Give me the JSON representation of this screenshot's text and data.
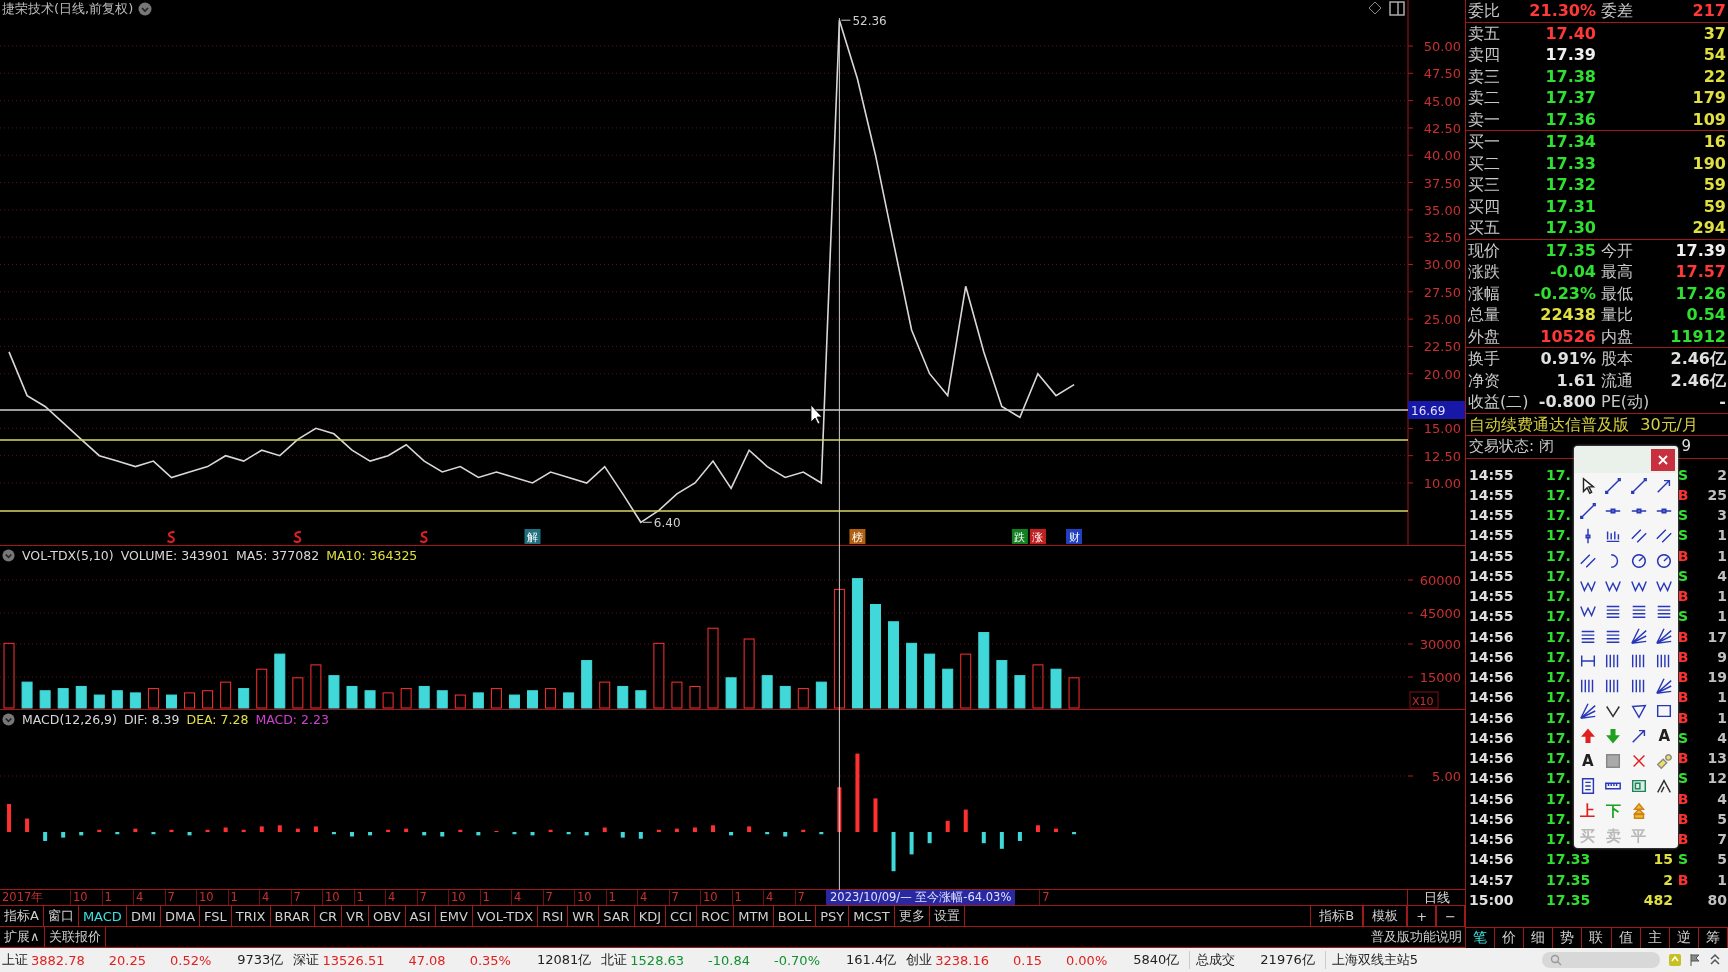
{
  "title": "捷荣技术(日线,前复权)",
  "price_pane": {
    "chart_data": {
      "type": "line",
      "grid": true,
      "ylim": [
        4.23,
        54.21
      ],
      "yticks": [
        {
          "value": 50,
          "label": "50.00"
        },
        {
          "value": 47.5,
          "label": "47.50"
        },
        {
          "value": 45,
          "label": "45.00"
        },
        {
          "value": 42.5,
          "label": "42.50"
        },
        {
          "value": 40,
          "label": "40.00"
        },
        {
          "value": 37.5,
          "label": "37.50"
        },
        {
          "value": 35,
          "label": "35.00"
        },
        {
          "value": 32.5,
          "label": "32.50"
        },
        {
          "value": 30,
          "label": "30.00"
        },
        {
          "value": 27.5,
          "label": "27.50"
        },
        {
          "value": 25,
          "label": "25.00"
        },
        {
          "value": 22.5,
          "label": "22.50"
        },
        {
          "value": 20,
          "label": "20.00"
        },
        {
          "value": 15,
          "label": "15.00"
        },
        {
          "value": 12.5,
          "label": "12.50"
        },
        {
          "value": 10,
          "label": "10.00"
        }
      ],
      "series": [
        {
          "color": "#d8d8d8",
          "values": [
            22,
            18,
            17,
            15.5,
            14,
            12.5,
            12,
            11.5,
            12,
            10.5,
            11,
            11.5,
            12.5,
            12,
            13,
            12.5,
            14,
            15,
            14.5,
            13,
            12,
            12.5,
            13.5,
            12,
            11,
            11.5,
            10.5,
            11,
            10.5,
            10,
            11,
            10.5,
            10,
            11.5,
            9,
            6.4,
            7.5,
            9,
            10,
            12,
            9.5,
            13,
            11.5,
            10.5,
            11,
            10,
            52.36,
            47,
            40,
            32,
            24,
            20,
            18,
            28,
            22,
            17,
            16,
            20,
            18,
            19
          ]
        }
      ],
      "annotations": [
        "52.36",
        "6.40"
      ]
    },
    "crosshair_label": "16.69",
    "markers": [
      {
        "kind": "flag"
      },
      {
        "kind": "flag"
      },
      {
        "kind": "flag"
      },
      {
        "kind": "tag",
        "label": "解",
        "color": "#207080"
      },
      {
        "kind": "tag",
        "label": "榜",
        "color": "#b06010"
      },
      {
        "kind": "tag",
        "label": "跌",
        "color": "#108020"
      },
      {
        "kind": "tag",
        "label": "涨",
        "color": "#c02020"
      },
      {
        "kind": "tag",
        "label": "财",
        "color": "#2040c0"
      }
    ]
  },
  "volume_pane": {
    "header": [
      {
        "text": "VOL-TDX(5,10)"
      },
      {
        "text": "VOLUME: 343901"
      },
      {
        "text": "MA5: 377082"
      },
      {
        "text": "MA10: 364325",
        "color": "#e0e040"
      }
    ],
    "scale_label": "X10",
    "axis_labels": [
      "60000",
      "45000",
      "30000",
      "15000"
    ]
  },
  "macd_pane": {
    "header": [
      {
        "text": "MACD(12,26,9)"
      },
      {
        "text": "DIF: 8.39"
      },
      {
        "text": "DEA: 7.28",
        "color": "#e0e040"
      },
      {
        "text": "MACD: 2.23",
        "color": "#d040d0"
      }
    ],
    "axis_labels": [
      "5.00"
    ]
  },
  "date_axis": {
    "labels": [
      "2017年",
      "10",
      "1",
      "4",
      "7",
      "10",
      "1",
      "4",
      "7",
      "10",
      "1",
      "4",
      "7",
      "10",
      "1",
      "4",
      "7",
      "10",
      "1",
      "4",
      "7",
      "10",
      "1",
      "4",
      "7"
    ],
    "highlight": "2023/10/09/— 至今涨幅-64.03%",
    "after": "7",
    "period": "日线"
  },
  "indicator_tabs": [
    {
      "label": "指标A",
      "selected": false
    },
    {
      "label": "窗口",
      "selected": false
    },
    {
      "label": "MACD",
      "selected": true
    },
    {
      "label": "DMI",
      "selected": false
    },
    {
      "label": "DMA",
      "selected": false
    },
    {
      "label": "FSL",
      "selected": false
    },
    {
      "label": "TRIX",
      "selected": false
    },
    {
      "label": "BRAR",
      "selected": false
    },
    {
      "label": "CR",
      "selected": false
    },
    {
      "label": "VR",
      "selected": false
    },
    {
      "label": "OBV",
      "selected": false
    },
    {
      "label": "ASI",
      "selected": false
    },
    {
      "label": "EMV",
      "selected": false
    },
    {
      "label": "VOL-TDX",
      "selected": false
    },
    {
      "label": "RSI",
      "selected": false
    },
    {
      "label": "WR",
      "selected": false
    },
    {
      "label": "SAR",
      "selected": false
    },
    {
      "label": "KDJ",
      "selected": false
    },
    {
      "label": "CCI",
      "selected": false
    },
    {
      "label": "ROC",
      "selected": false
    },
    {
      "label": "MTM",
      "selected": false
    },
    {
      "label": "BOLL",
      "selected": false
    },
    {
      "label": "PSY",
      "selected": false
    },
    {
      "label": "MCST",
      "selected": false
    },
    {
      "label": "更多",
      "selected": false
    },
    {
      "label": "设置",
      "selected": false
    }
  ],
  "right_buttons": [
    "指标B",
    "模板",
    "+",
    "−"
  ],
  "extension_buttons": [
    "扩展∧",
    "关联报价"
  ],
  "help_link": "普及版功能说明",
  "quote": {
    "ratio": {
      "left": {
        "label": "委比",
        "value": "21.30%",
        "color": "#ff3838"
      },
      "right": {
        "label": "委差",
        "value": "217",
        "color": "#ff3838"
      }
    },
    "asks": [
      {
        "label": "卖五",
        "price": "17.40",
        "color": "#ff3838",
        "volume": "37"
      },
      {
        "label": "卖四",
        "price": "17.39",
        "color": "#f0f0f0",
        "volume": "54"
      },
      {
        "label": "卖三",
        "price": "17.38",
        "color": "#30e030",
        "volume": "22"
      },
      {
        "label": "卖二",
        "price": "17.37",
        "color": "#30e030",
        "volume": "179"
      },
      {
        "label": "卖一",
        "price": "17.36",
        "color": "#30e030",
        "volume": "109"
      }
    ],
    "bids": [
      {
        "label": "买一",
        "price": "17.34",
        "color": "#30e030",
        "volume": "16"
      },
      {
        "label": "买二",
        "price": "17.33",
        "color": "#30e030",
        "volume": "190"
      },
      {
        "label": "买三",
        "price": "17.32",
        "color": "#30e030",
        "volume": "59"
      },
      {
        "label": "买四",
        "price": "17.31",
        "color": "#30e030",
        "volume": "59"
      },
      {
        "label": "买五",
        "price": "17.30",
        "color": "#30e030",
        "volume": "294"
      }
    ],
    "stats": [
      {
        "left": {
          "label": "现价",
          "value": "17.35",
          "color": "#30e030"
        },
        "right": {
          "label": "今开",
          "value": "17.39",
          "color": "#f0f0f0"
        }
      },
      {
        "left": {
          "label": "涨跌",
          "value": "-0.04",
          "color": "#30e030"
        },
        "right": {
          "label": "最高",
          "value": "17.57",
          "color": "#ff3838"
        }
      },
      {
        "left": {
          "label": "涨幅",
          "value": "-0.23%",
          "color": "#30e030"
        },
        "right": {
          "label": "最低",
          "value": "17.26",
          "color": "#30e030"
        }
      },
      {
        "left": {
          "label": "总量",
          "value": "22438",
          "color": "#e0e040"
        },
        "right": {
          "label": "量比",
          "value": "0.54",
          "color": "#30e030"
        }
      },
      {
        "left": {
          "label": "外盘",
          "value": "10526",
          "color": "#ff3838"
        },
        "right": {
          "label": "内盘",
          "value": "11912",
          "color": "#30e030"
        }
      }
    ],
    "fundamentals": [
      {
        "left": {
          "label": "换手",
          "value": "0.91%"
        },
        "right": {
          "label": "股本",
          "value": "2.46亿"
        }
      },
      {
        "left": {
          "label": "净资",
          "value": "1.61"
        },
        "right": {
          "label": "流通",
          "value": "2.46亿"
        }
      },
      {
        "left": {
          "label": "收益(二)",
          "value": "-0.800"
        },
        "right": {
          "label": "PE(动)",
          "value": "-"
        }
      }
    ],
    "promo": {
      "text": "自动续费通达信普及版",
      "price": "30元/月"
    },
    "trade_status": {
      "text": "交易状态: 闭",
      "suffix": "9"
    }
  },
  "ticks": [
    {
      "time": "14:55",
      "price": "17.",
      "side": "S",
      "buy": false,
      "count": "2"
    },
    {
      "time": "14:55",
      "price": "17.",
      "side": "B",
      "buy": true,
      "count": "25"
    },
    {
      "time": "14:55",
      "price": "17.",
      "side": "S",
      "buy": false,
      "count": "3"
    },
    {
      "time": "14:55",
      "price": "17.",
      "side": "S",
      "buy": false,
      "count": "1"
    },
    {
      "time": "14:55",
      "price": "17.",
      "side": "B",
      "buy": true,
      "count": "1"
    },
    {
      "time": "14:55",
      "price": "17.",
      "side": "S",
      "buy": false,
      "count": "4"
    },
    {
      "time": "14:55",
      "price": "17.",
      "side": "B",
      "buy": true,
      "count": "1"
    },
    {
      "time": "14:55",
      "price": "17.",
      "side": "S",
      "buy": false,
      "count": "1"
    },
    {
      "time": "14:56",
      "price": "17.",
      "side": "B",
      "buy": true,
      "count": "17"
    },
    {
      "time": "14:56",
      "price": "17.",
      "side": "B",
      "buy": true,
      "count": "9"
    },
    {
      "time": "14:56",
      "price": "17.",
      "side": "B",
      "buy": true,
      "count": "19"
    },
    {
      "time": "14:56",
      "price": "17.",
      "side": "B",
      "buy": true,
      "count": "1"
    },
    {
      "time": "14:56",
      "price": "17.",
      "side": "B",
      "buy": true,
      "count": "1"
    },
    {
      "time": "14:56",
      "price": "17.",
      "side": "S",
      "buy": false,
      "count": "4"
    },
    {
      "time": "14:56",
      "price": "17.",
      "side": "B",
      "buy": true,
      "count": "13"
    },
    {
      "time": "14:56",
      "price": "17.",
      "side": "S",
      "buy": false,
      "count": "12"
    },
    {
      "time": "14:56",
      "price": "17.",
      "side": "B",
      "buy": true,
      "count": "4"
    },
    {
      "time": "14:56",
      "price": "17.",
      "side": "B",
      "buy": true,
      "count": "5"
    },
    {
      "time": "14:56",
      "price": "17.",
      "side": "B",
      "buy": true,
      "count": "7"
    },
    {
      "time": "14:56",
      "price": "17.33",
      "volume": "15",
      "side": "S",
      "buy": false,
      "count": "5"
    },
    {
      "time": "14:57",
      "price": "17.35",
      "volume": "2",
      "side": "B",
      "buy": true,
      "count": "1"
    },
    {
      "time": "15:00",
      "price": "17.35",
      "volume": "482",
      "count": "80"
    }
  ],
  "panel_tabs": [
    {
      "label": "笔",
      "selected": true
    },
    {
      "label": "价",
      "selected": false
    },
    {
      "label": "细",
      "selected": false
    },
    {
      "label": "势",
      "selected": false
    },
    {
      "label": "联",
      "selected": false
    },
    {
      "label": "值",
      "selected": false
    },
    {
      "label": "主",
      "selected": false
    },
    {
      "label": "逆",
      "selected": false
    },
    {
      "label": "筹",
      "selected": false
    }
  ],
  "palette": {
    "rows": [
      [
        {
          "kind": "cursor"
        },
        {
          "kind": "line"
        },
        {
          "kind": "line"
        },
        {
          "kind": "arrow"
        }
      ],
      [
        {
          "kind": "line"
        },
        {
          "kind": "segment"
        },
        {
          "kind": "segment"
        },
        {
          "kind": "segment"
        }
      ],
      [
        {
          "kind": "vertical"
        },
        {
          "kind": "scale"
        },
        {
          "kind": "parallel"
        },
        {
          "kind": "parallel"
        }
      ],
      [
        {
          "kind": "parallel"
        },
        {
          "kind": "arc"
        },
        {
          "kind": "circle"
        },
        {
          "kind": "circle"
        }
      ],
      [
        {
          "kind": "wave"
        },
        {
          "kind": "wave"
        },
        {
          "kind": "wave"
        },
        {
          "kind": "wave"
        }
      ],
      [
        {
          "kind": "wave"
        },
        {
          "kind": "lines"
        },
        {
          "kind": "lines"
        },
        {
          "kind": "lines"
        }
      ],
      [
        {
          "kind": "lines"
        },
        {
          "kind": "lines"
        },
        {
          "kind": "fan"
        },
        {
          "kind": "fan"
        }
      ],
      [
        {
          "kind": "period"
        },
        {
          "kind": "bars"
        },
        {
          "kind": "bars"
        },
        {
          "kind": "bars"
        }
      ],
      [
        {
          "kind": "bars"
        },
        {
          "kind": "bars"
        },
        {
          "kind": "bars"
        },
        {
          "kind": "fan"
        }
      ],
      [
        {
          "kind": "fan"
        },
        {
          "kind": "angle"
        },
        {
          "kind": "triangle"
        },
        {
          "kind": "rect"
        }
      ],
      [
        {
          "kind": "up"
        },
        {
          "kind": "down"
        },
        {
          "kind": "arrow"
        },
        {
          "kind": "text",
          "label": "A",
          "color": "#202020"
        }
      ],
      [
        {
          "kind": "text",
          "label": "A",
          "color": "#202020"
        },
        {
          "kind": "square"
        },
        {
          "kind": "cross"
        },
        {
          "kind": "eraser"
        }
      ],
      [
        {
          "kind": "document"
        },
        {
          "kind": "ruler"
        },
        {
          "kind": "frame"
        },
        {
          "kind": "peak"
        }
      ],
      [
        {
          "kind": "text",
          "label": "上",
          "color": "#e02020"
        },
        {
          "kind": "text",
          "label": "下",
          "color": "#20a020"
        },
        {
          "kind": "stack"
        }
      ],
      [
        {
          "kind": "text",
          "label": "买",
          "color": "#b8b8b8"
        },
        {
          "kind": "text",
          "label": "卖",
          "color": "#b8b8b8"
        },
        {
          "kind": "text",
          "label": "平",
          "color": "#b8b8b8"
        }
      ]
    ]
  },
  "status_bar": {
    "indices": [
      {
        "name": "上证",
        "value": "3882.78",
        "change": "20.25",
        "pct": "0.52%",
        "amount": "9733亿",
        "up": true
      },
      {
        "name": "深证",
        "value": "13526.51",
        "change": "47.08",
        "pct": "0.35%",
        "amount": "12081亿",
        "up": true
      },
      {
        "name": "北证",
        "value": "1528.63",
        "change": "-10.84",
        "pct": "-0.70%",
        "amount": "161.4亿",
        "up": false
      },
      {
        "name": "创业",
        "value": "3238.16",
        "change": "0.15",
        "pct": "0.00%",
        "amount": "5840亿",
        "up": true
      }
    ],
    "total_label": "总成交",
    "total": "21976亿",
    "server": "上海双线主站5"
  }
}
